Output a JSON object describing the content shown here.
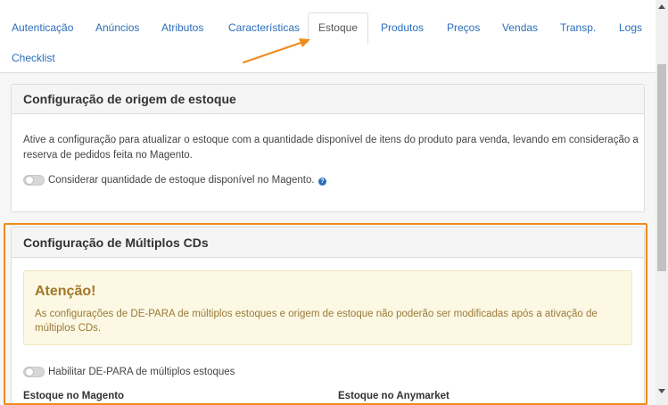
{
  "tabs": [
    {
      "label": "Autenticação",
      "active": false
    },
    {
      "label": "Anúncios",
      "active": false
    },
    {
      "label": "Atributos",
      "active": false
    },
    {
      "label": "Características",
      "active": false
    },
    {
      "label": "Estoque",
      "active": true
    },
    {
      "label": "Produtos",
      "active": false
    },
    {
      "label": "Preços",
      "active": false
    },
    {
      "label": "Vendas",
      "active": false
    },
    {
      "label": "Transp.",
      "active": false
    },
    {
      "label": "Logs",
      "active": false
    },
    {
      "label": "Checklist",
      "active": false
    }
  ],
  "stock_origin": {
    "title": "Configuração de origem de estoque",
    "description_line1": "Ative a configuração para atualizar o estoque com a quantidade disponível de itens do produto para venda, levando em consideração a",
    "description_line2": "reserva de pedidos feita no Magento.",
    "toggle_label": "Considerar quantidade de estoque disponível no Magento.",
    "toggle_on": false
  },
  "multi_cd": {
    "title": "Configuração de Múltiplos CDs",
    "alert_title": "Atenção!",
    "alert_line1": "As configurações de DE-PARA de múltiplos estoques e origem de estoque não poderão ser modificadas após a ativação de",
    "alert_line2": "múltiplos CDs.",
    "toggle_label": "Habilitar DE-PARA de múltiplos estoques",
    "toggle_on": false,
    "col_magento": "Estoque no Magento",
    "col_anymarket": "Estoque no Anymarket"
  },
  "colors": {
    "link": "#2a6ebb",
    "highlight": "#f08a1c",
    "alert_bg": "#fcf8e3"
  }
}
